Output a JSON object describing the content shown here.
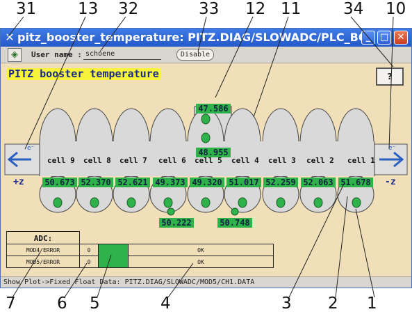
{
  "callouts": {
    "top": [
      "31",
      "13",
      "32",
      "33",
      "12",
      "11",
      "34",
      "10"
    ],
    "bottom": [
      "7",
      "6",
      "5",
      "4",
      "3",
      "2",
      "1"
    ]
  },
  "window": {
    "title": "pitz_booster_temperature: PITZ.DIAG/SLOWADC/PLC_BOOSTER/",
    "buttons": {
      "minimize": "_",
      "maximize": "□",
      "close": "✕"
    }
  },
  "toolbar": {
    "user_label": "User name :",
    "user_value": "schoene",
    "disable_label": "Disable"
  },
  "panel": {
    "title": "PITZ booster temperature",
    "help_label": "?",
    "plus_z": "+z",
    "minus_z": "-z",
    "coupler_top": "47.586",
    "coupler_bottom": "48.955",
    "cells": [
      "cell 9",
      "cell 8",
      "cell 7",
      "cell 6",
      "cell 5",
      "cell 4",
      "cell 3",
      "cell 2",
      "cell 1"
    ],
    "cell_temps": [
      "50.673",
      "52.370",
      "52.621",
      "49.373",
      "49.320",
      "51.017",
      "52.259",
      "52.063",
      "51.678"
    ],
    "extra_temps": [
      "50.222",
      "50.748"
    ]
  },
  "adc": {
    "header": "ADC:",
    "rows": [
      {
        "label": "MOD4/ERROR",
        "value": "0",
        "status": "OK"
      },
      {
        "label": "MOD5/ERROR",
        "value": "0",
        "status": "OK"
      }
    ]
  },
  "statusbar": {
    "text": "Show Plot->Fixed Float Data: PITZ.DIAG/SLOWADC/MOD5/CH1.DATA"
  },
  "colors": {
    "panel_bg": "#f1dfb9",
    "cavity_fill": "#d9d9d9",
    "indicator_green": "#2fb24a",
    "title_highlight": "#f7f23a",
    "beam_arrow": "#2a5fbf"
  },
  "icons": [
    "app-icon",
    "tool-icon",
    "beam-arrow-left-icon",
    "beam-arrow-right-icon",
    "sensor-icon"
  ]
}
